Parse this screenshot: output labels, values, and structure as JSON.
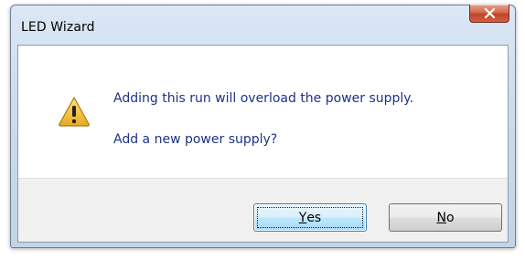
{
  "window": {
    "title": "LED Wizard"
  },
  "message": {
    "line1": "Adding this run will overload the power supply.",
    "line2": "Add a new power supply?"
  },
  "buttons": {
    "yes": {
      "mnemonic": "Y",
      "rest": "es"
    },
    "no": {
      "mnemonic": "N",
      "rest": "o"
    }
  },
  "icons": {
    "warning": "warning-triangle-icon",
    "close": "close-icon"
  },
  "colors": {
    "message_text": "#1e3287",
    "close_button": "#c2452b",
    "warning_fill": "#f5c242"
  }
}
